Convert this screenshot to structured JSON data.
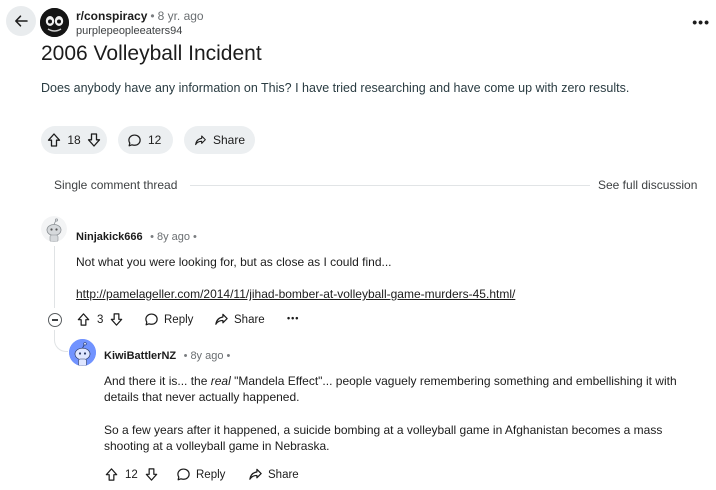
{
  "header": {
    "subreddit": "r/conspiracy",
    "age": "8 yr. ago",
    "author": "purplepeopleeaters94",
    "more": "•••"
  },
  "post": {
    "title": "2006 Volleyball Incident",
    "body": "Does anybody have any information on This? I have tried researching and have come up with zero results.",
    "votes": "18",
    "comments": "12",
    "share_label": "Share"
  },
  "thread": {
    "label": "Single comment thread",
    "see_full": "See full discussion"
  },
  "comments": [
    {
      "author": "Ninjakick666",
      "age": "8y ago",
      "text": "Not what you were looking for, but as close as I could find...",
      "link": "http://pamelageller.com/2014/11/jihad-bomber-at-volleyball-game-murders-45.html/",
      "votes": "3",
      "reply_label": "Reply",
      "share_label": "Share",
      "more": "•••"
    },
    {
      "author": "KiwiBattlerNZ",
      "age": "8y ago",
      "text_pre": "And there it is... the ",
      "text_em": "real",
      "text_post": " \"Mandela Effect\"... people vaguely remembering something and embellishing it with details that never actually happened.",
      "text2": "So a few years after it happened, a suicide bombing at a volleyball game in Afghanistan becomes a mass shooting at a volleyball game in Nebraska.",
      "votes": "12",
      "reply_label": "Reply",
      "share_label": "Share"
    }
  ],
  "colors": {
    "pill_bg": "#eceff1",
    "text": "#1c1c1c",
    "muted": "#6b6f72",
    "avatar_blue": "#7193ff"
  }
}
